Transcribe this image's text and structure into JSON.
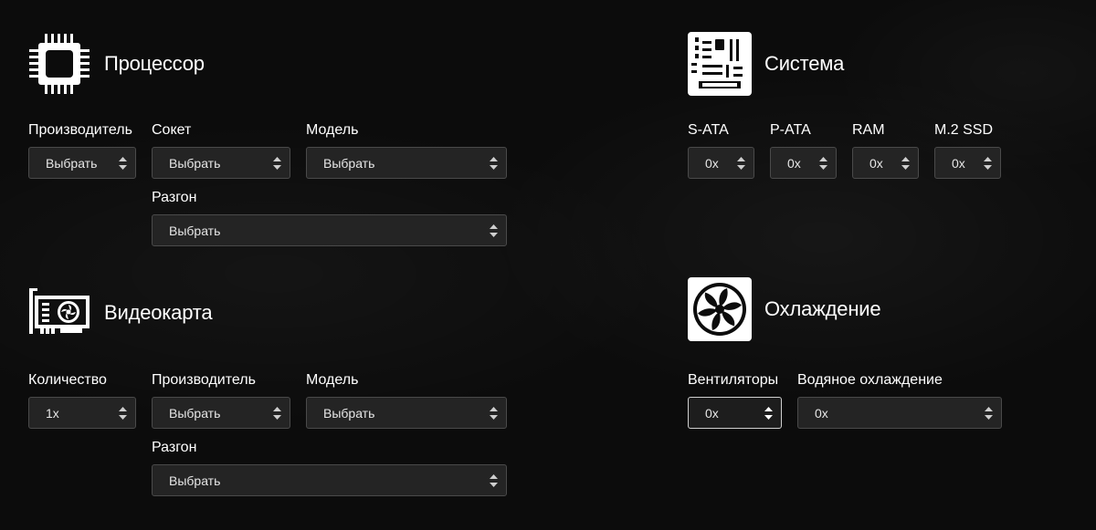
{
  "processor": {
    "title": "Процессор",
    "manufacturer_label": "Производитель",
    "manufacturer_value": "Выбрать",
    "socket_label": "Сокет",
    "socket_value": "Выбрать",
    "model_label": "Модель",
    "model_value": "Выбрать",
    "overclock_label": "Разгон",
    "overclock_value": "Выбрать"
  },
  "system": {
    "title": "Система",
    "sata_label": "S-ATA",
    "sata_value": "0x",
    "pata_label": "P-ATA",
    "pata_value": "0x",
    "ram_label": "RAM",
    "ram_value": "0x",
    "m2_label": "M.2 SSD",
    "m2_value": "0x"
  },
  "gpu": {
    "title": "Видеокарта",
    "count_label": "Количество",
    "count_value": "1x",
    "manufacturer_label": "Производитель",
    "manufacturer_value": "Выбрать",
    "model_label": "Модель",
    "model_value": "Выбрать",
    "overclock_label": "Разгон",
    "overclock_value": "Выбрать"
  },
  "cooling": {
    "title": "Охлаждение",
    "fans_label": "Вентиляторы",
    "fans_value": "0x",
    "water_label": "Водяное охлаждение",
    "water_value": "0x"
  },
  "icons": {
    "processor": "cpu-chip-icon",
    "system": "motherboard-icon",
    "gpu": "graphics-card-icon",
    "cooling": "fan-icon"
  }
}
